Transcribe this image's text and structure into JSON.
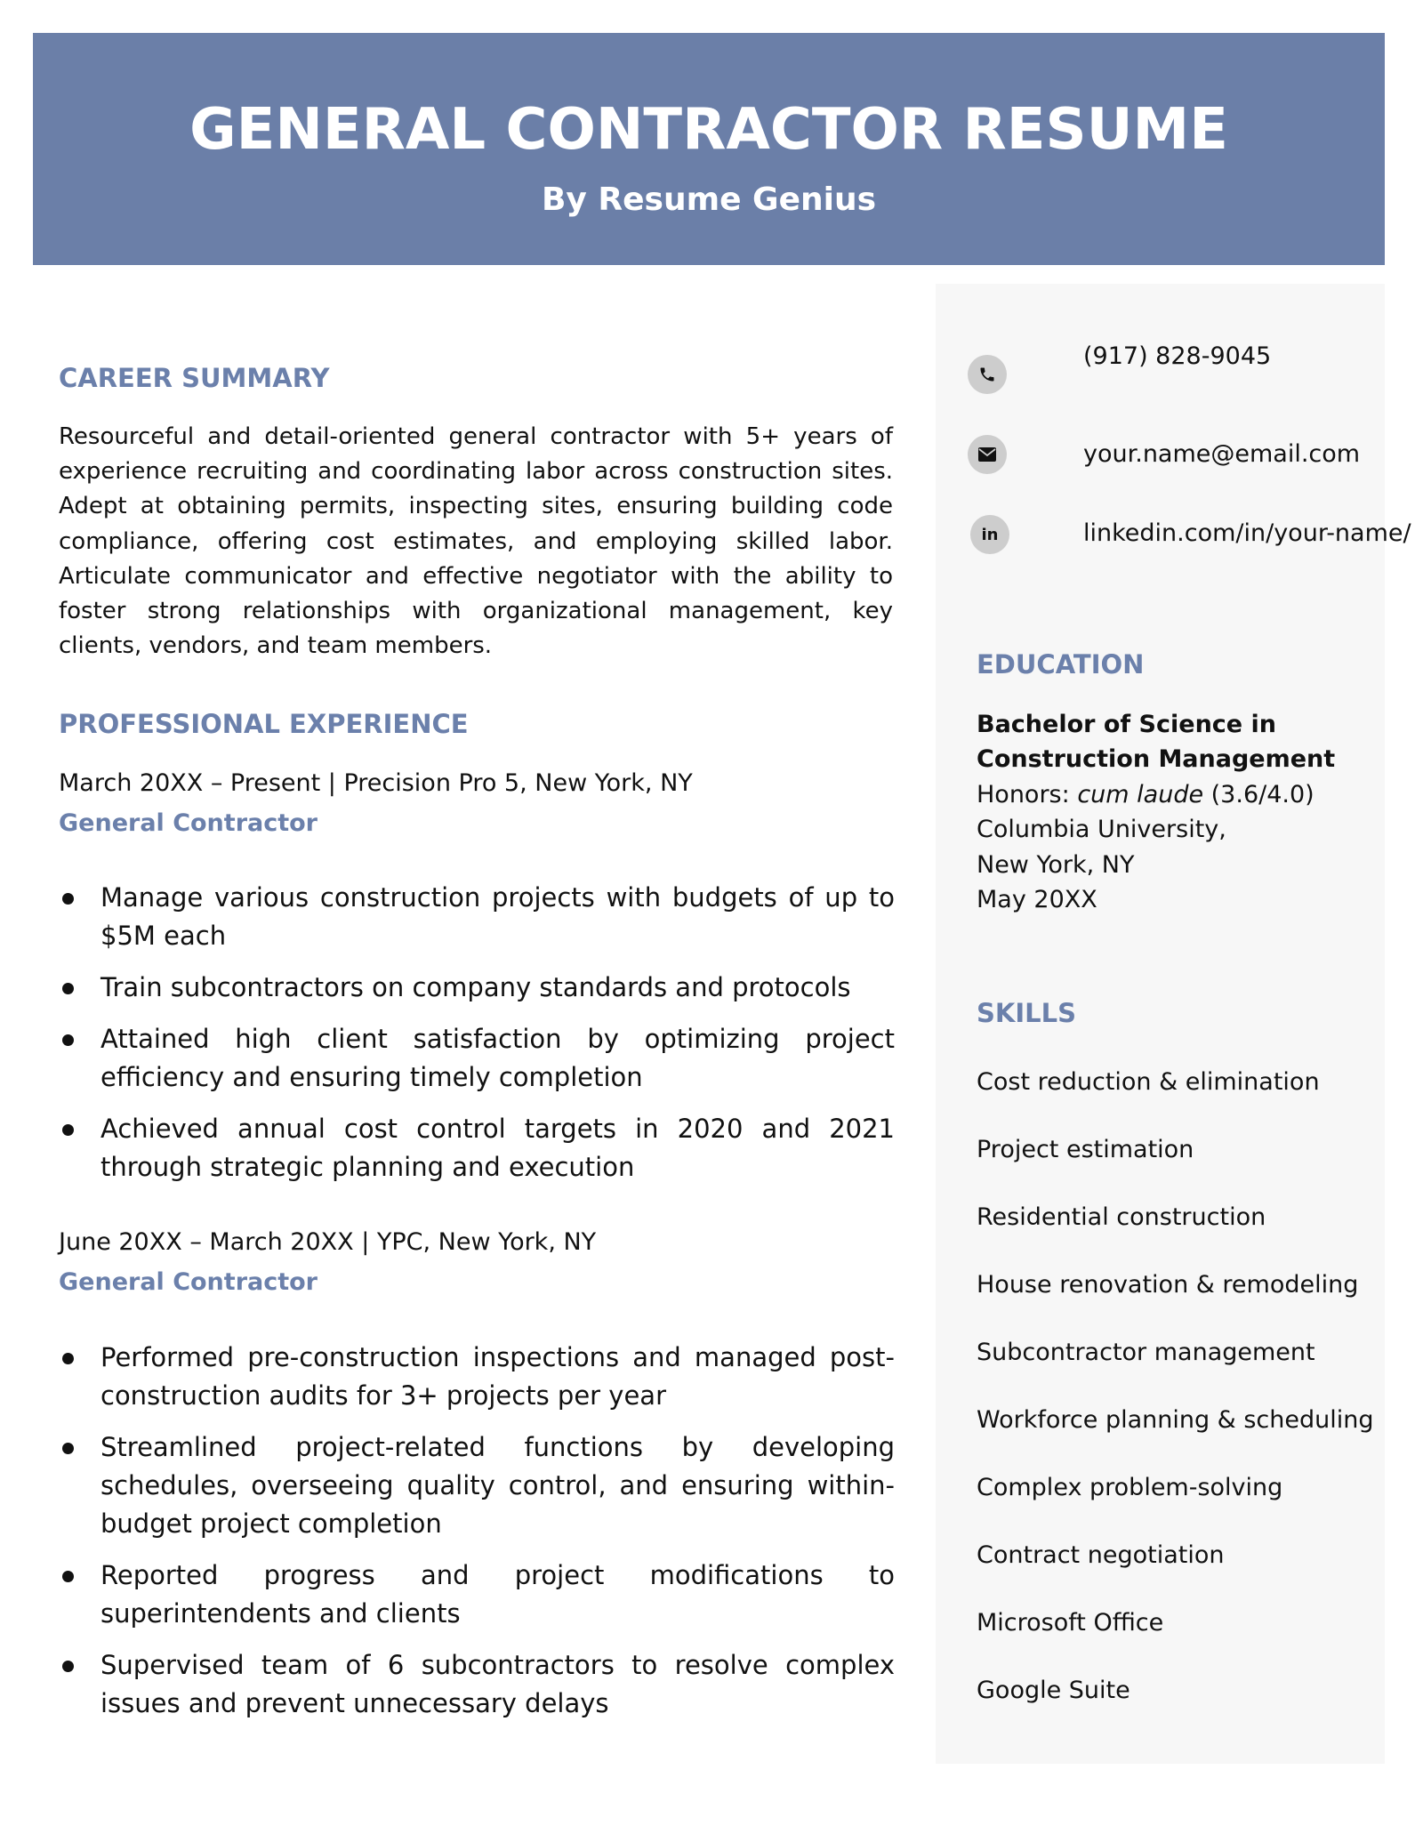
{
  "header": {
    "title": "GENERAL CONTRACTOR RESUME",
    "subtitle": "By Resume Genius",
    "background_color": "#6B7FA8"
  },
  "accent_color": "#6B80AB",
  "career_summary": {
    "heading": "CAREER SUMMARY",
    "text": "Resourceful and detail-oriented general contractor with 5+ years of experience recruiting and coordinating labor across construction sites. Adept at obtaining permits, inspecting sites, ensuring building code compliance, offering cost estimates, and employing skilled labor. Articulate communicator and effective negotiator with the ability to foster strong relationships with organizational management, key clients, vendors, and team members."
  },
  "experience": {
    "heading": "PROFESSIONAL EXPERIENCE",
    "jobs": [
      {
        "meta": "March 20XX – Present | Precision Pro 5, New York, NY",
        "title": "General Contractor",
        "bullets": [
          "Manage various construction projects with budgets of up to $5M each",
          "Train subcontractors on company standards and protocols",
          "Attained high client satisfaction by optimizing project efficiency and ensuring timely completion",
          "Achieved annual cost control targets in 2020 and 2021 through strategic planning and execution"
        ]
      },
      {
        "meta": "June 20XX – March 20XX | YPC, New York, NY",
        "title": "General Contractor",
        "bullets": [
          "Performed pre-construction inspections and managed post-construction audits for 3+ projects per year",
          "Streamlined project-related functions by developing schedules, overseeing quality control, and ensuring within-budget project completion",
          "Reported progress and project modifications to superintendents and clients",
          "Supervised team of 6 subcontractors to resolve complex issues and prevent unnecessary delays"
        ]
      }
    ]
  },
  "contact": {
    "phone": {
      "icon": "phone-icon",
      "text": "(917) 828-9045"
    },
    "email": {
      "icon": "email-icon",
      "text": "your.name@email.com"
    },
    "linkedin": {
      "icon": "linkedin-icon",
      "text": "linkedin.com/in/your-name/"
    }
  },
  "education": {
    "heading": "EDUCATION",
    "degree_line1": "Bachelor of Science in",
    "degree_line2": "Construction Management",
    "honors_label": "Honors: ",
    "honors_value": "cum laude",
    "gpa": " (3.6/4.0)",
    "school": "Columbia University,",
    "location": "New York, NY",
    "date": "May 20XX"
  },
  "skills": {
    "heading": "SKILLS",
    "items": [
      "Cost reduction & elimination",
      "Project estimation",
      "Residential construction",
      "House renovation & remodeling",
      "Subcontractor management",
      "Workforce planning & scheduling",
      "Complex problem-solving",
      "Contract negotiation",
      "Microsoft Office",
      "Google Suite"
    ]
  }
}
